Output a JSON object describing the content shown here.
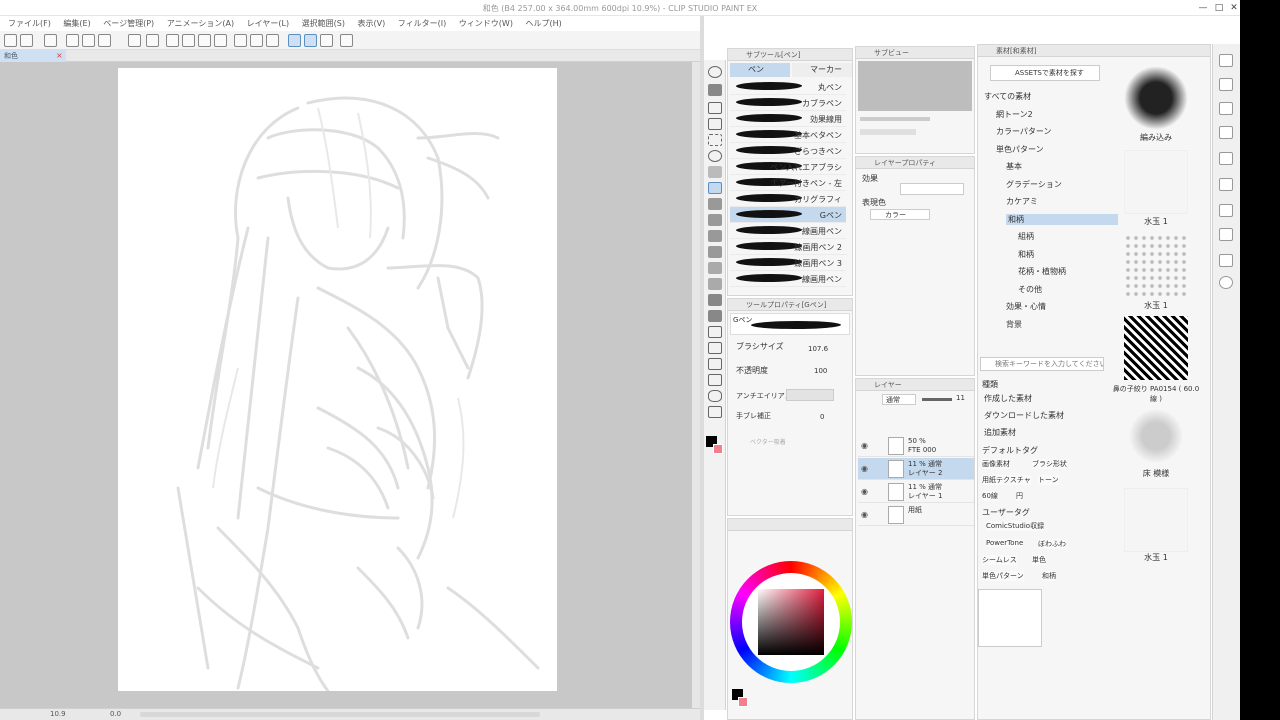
{
  "window": {
    "title": "和色 (B4 257.00 x 364.00mm 600dpi 10.9%)  - CLIP STUDIO PAINT EX",
    "minimize": "—",
    "maximize": "□",
    "close": "✕"
  },
  "menu": [
    "ファイル(F)",
    "編集(E)",
    "ページ管理(P)",
    "アニメーション(A)",
    "レイヤー(L)",
    "選択範囲(S)",
    "表示(V)",
    "フィルター(I)",
    "ウィンドウ(W)",
    "ヘルプ(H)"
  ],
  "canvas_tab": {
    "label": "和色",
    "close": "×"
  },
  "status": {
    "zoom": "10.9",
    "angle": "0.0"
  },
  "subtool_panel": {
    "header": "サブツール[ペン]",
    "tabs": [
      "ペン",
      "マーカー"
    ],
    "brushes": [
      "丸ペン",
      "カブラペン",
      "効果線用",
      "基本ベタペン",
      "ざらつきペン",
      "ペン入れエアブラシ",
      "エアー付きペン - 左",
      "カリグラフィ",
      "Gペン",
      "線画用ペン",
      "線画用ペン 2",
      "線画用ペン 3",
      "線画用ペン"
    ],
    "selected_index": 8
  },
  "tool_property": {
    "header": "ツールプロパティ[Gペン]",
    "brush_name": "Gペン",
    "brush_size_label": "ブラシサイズ",
    "brush_size_value": "107.6",
    "opacity_label": "不透明度",
    "opacity_value": "100",
    "antialias_label": "アンチエイリアス",
    "stabilization_label": "手ブレ補正",
    "stabilization_value": "0",
    "vector_label": "ベクター吸着"
  },
  "sub_view": {
    "header": "サブビュー"
  },
  "layer_property": {
    "header": "レイヤープロパティ",
    "effect_label": "効果",
    "color_label": "表現色",
    "color_value": "カラー"
  },
  "layers": {
    "header": "レイヤー",
    "blend_mode": "通常",
    "opacity": "11",
    "rows": [
      {
        "meta": "50 %",
        "name": "FTE 000"
      },
      {
        "meta": "11 % 通常",
        "name": "レイヤー 2"
      },
      {
        "meta": "11 % 通常",
        "name": "レイヤー 1"
      },
      {
        "meta": "",
        "name": "用紙"
      }
    ],
    "selected_index": 1
  },
  "materials": {
    "header": "素材[和素材]",
    "assets_button": "ASSETSで素材を探す",
    "tree": [
      "すべての素材",
      "網トーン2",
      "カラーパターン",
      "単色パターン",
      "基本",
      "グラデーション",
      "カケアミ",
      "和柄",
      "組柄",
      "和柄",
      "花柄・植物柄",
      "その他",
      "効果・心情",
      "背景"
    ],
    "selected_index": 7,
    "search_placeholder": "検索キーワードを入力してください",
    "kind_label": "種類",
    "kinds": [
      "作成した素材",
      "ダウンロードした素材",
      "追加素材"
    ],
    "default_tags_label": "デフォルトタグ",
    "default_tags": [
      "画像素材",
      "ブラシ形状",
      "用紙テクスチャ",
      "トーン",
      "60線",
      "円"
    ],
    "user_tags_label": "ユーザータグ",
    "user_tags": [
      "ComicStudio収録",
      "PowerTone",
      "ぼわふわ",
      "シームレス",
      "単色",
      "単色パターン",
      "和柄"
    ],
    "thumbs": [
      "編み込み",
      "水玉 1",
      "水玉 1",
      "鼻の子絞り PA0154 ( 60.0線 )",
      "床 模様",
      "水玉 1"
    ]
  },
  "colors": {
    "accent": "#c4d9ee",
    "main_color": "#000000",
    "sub_color": "#f08090"
  }
}
